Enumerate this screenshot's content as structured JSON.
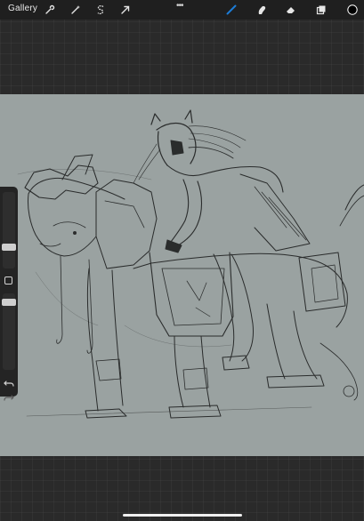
{
  "toolbar": {
    "gallery_label": "Gallery",
    "more_label": "•••",
    "icons": [
      "wrench-icon",
      "magic-wand-icon",
      "selection-s-icon",
      "transform-arrow-icon",
      "brush-icon",
      "smudge-icon",
      "eraser-icon",
      "layers-icon",
      "color-swatch-icon"
    ]
  },
  "canvas": {
    "background": "#9aa2a1",
    "subject": "sketch-armored-rider-on-beast"
  },
  "sidebar": {
    "brush_size_level": 0.55,
    "opacity_level": 0.18,
    "icons": [
      "modify-square-icon",
      "undo-icon",
      "redo-icon"
    ]
  },
  "colors": {
    "active_tool": "#1c7cd6",
    "current_color": "#000000"
  }
}
